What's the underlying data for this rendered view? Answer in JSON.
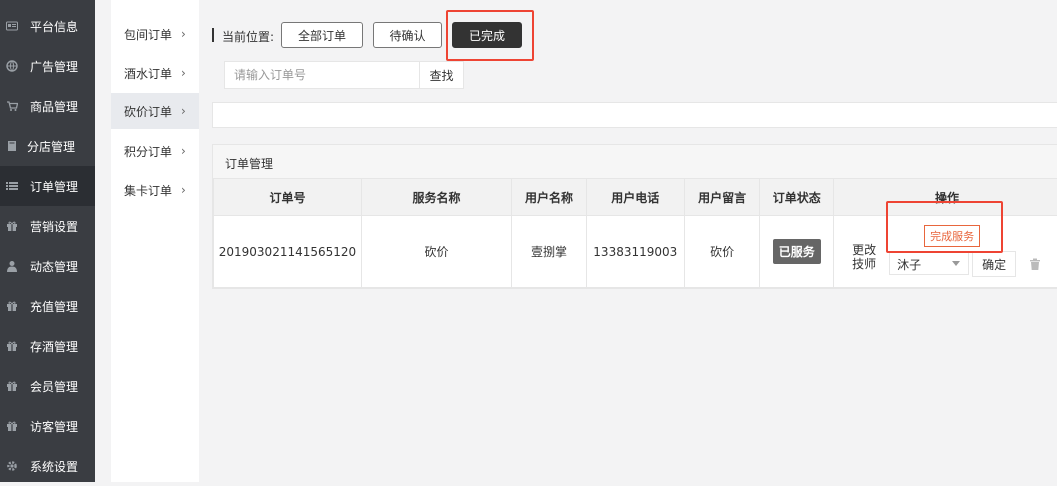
{
  "sidebar": {
    "items": [
      {
        "label": "平台信息",
        "icon": "id-card-icon"
      },
      {
        "label": "广告管理",
        "icon": "globe-icon"
      },
      {
        "label": "商品管理",
        "icon": "cart-icon"
      },
      {
        "label": "分店管理",
        "icon": "book-icon"
      },
      {
        "label": "订单管理",
        "icon": "list-icon"
      },
      {
        "label": "营销设置",
        "icon": "gift-icon"
      },
      {
        "label": "动态管理",
        "icon": "user-icon"
      },
      {
        "label": "充值管理",
        "icon": "gift-icon"
      },
      {
        "label": "存酒管理",
        "icon": "gift-icon"
      },
      {
        "label": "会员管理",
        "icon": "gift-icon"
      },
      {
        "label": "访客管理",
        "icon": "gift-icon"
      },
      {
        "label": "系统设置",
        "icon": "gear-icon"
      }
    ]
  },
  "subnav": {
    "items": [
      {
        "label": "包间订单",
        "chevron": "›"
      },
      {
        "label": "酒水订单",
        "chevron": "›"
      },
      {
        "label": "砍价订单",
        "chevron": "›"
      },
      {
        "label": "积分订单",
        "chevron": "›"
      },
      {
        "label": "集卡订单",
        "chevron": "›"
      }
    ]
  },
  "breadcrumb": {
    "label": "当前位置:"
  },
  "filters": {
    "all": "全部订单",
    "pending": "待确认",
    "done": "已完成"
  },
  "search": {
    "placeholder": "请输入订单号",
    "value": "",
    "button": "查找"
  },
  "panel": {
    "title": "订单管理"
  },
  "table": {
    "headers": [
      "订单号",
      "服务名称",
      "用户名称",
      "用户电话",
      "用户留言",
      "订单状态",
      "操作"
    ],
    "rows": [
      {
        "order_no": "201903021141565120",
        "service": "砍价",
        "user": "壹捌掌",
        "phone": "13383119003",
        "message": "砍价",
        "status": "已服务",
        "complete_btn": "完成服务",
        "change_label": "更改技师",
        "tech_value": "沐子",
        "confirm": "确定"
      }
    ]
  },
  "colors": {
    "highlight": "#e43",
    "accent": "#e8663d",
    "sidebar": "#3a3d42",
    "status_badge": "#666666"
  }
}
